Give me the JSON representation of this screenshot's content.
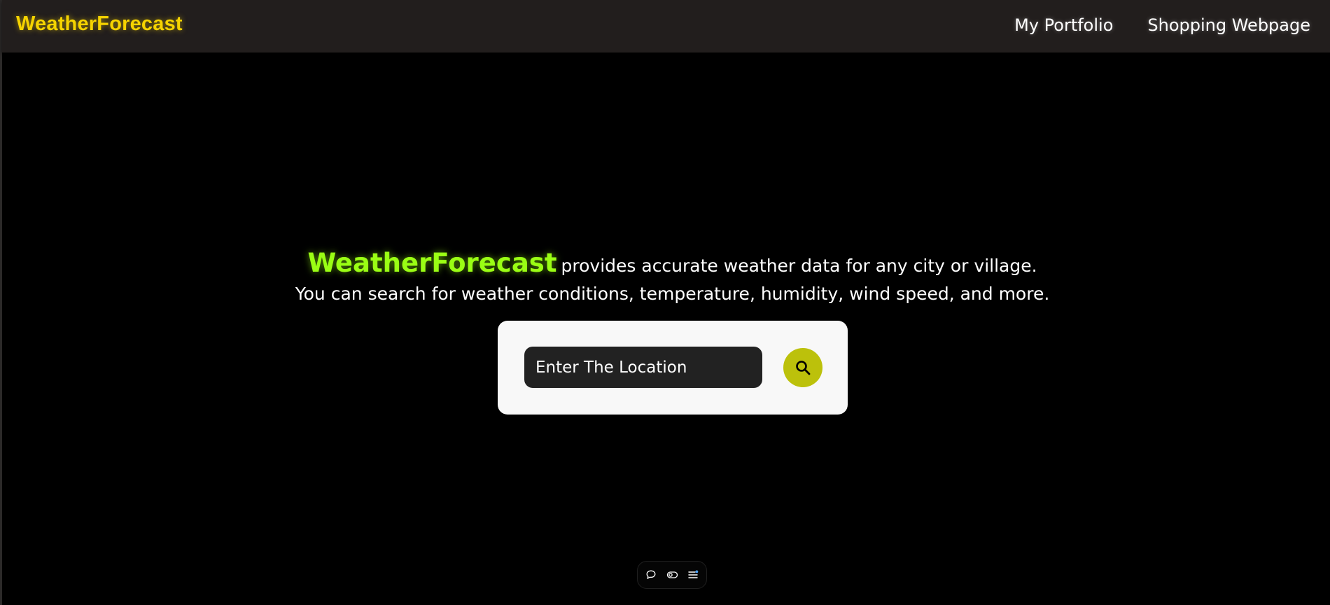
{
  "navbar": {
    "brand": "WeatherForecast",
    "links": [
      {
        "label": "My Portfolio"
      },
      {
        "label": "Shopping Webpage"
      }
    ]
  },
  "hero": {
    "brand": "WeatherForecast",
    "line1_text": "provides accurate weather data for any city or village.",
    "line2_text": "You can search for weather conditions, temperature, humidity, wind speed, and more."
  },
  "search": {
    "placeholder": "Enter The Location",
    "button_icon": "search-icon"
  },
  "toolbar": {
    "icons": [
      "chat-bubble-icon",
      "toggle-icon",
      "menu-list-icon"
    ]
  },
  "colors": {
    "brand_yellow": "#f5d300",
    "hero_green": "#9afe14",
    "search_button": "#bcc10b",
    "navbar_bg": "#221e1d",
    "page_bg": "#000000",
    "card_bg": "#f8f8f8",
    "input_bg": "#222222"
  }
}
